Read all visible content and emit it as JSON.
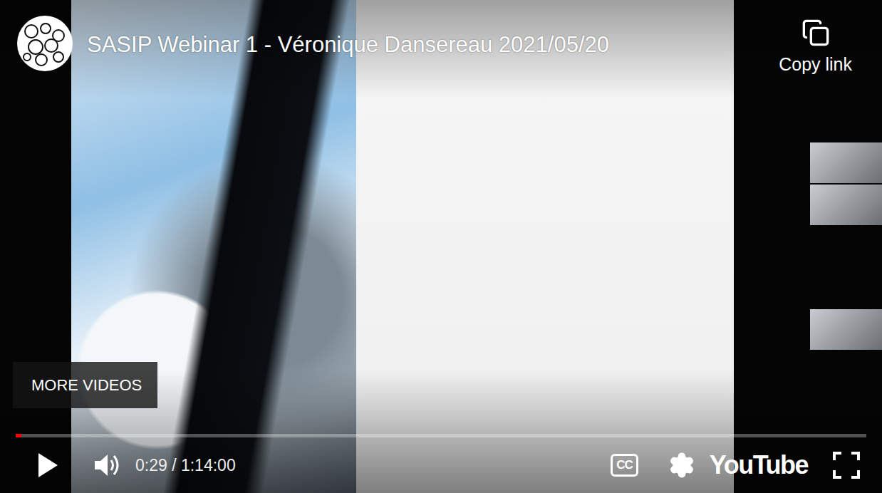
{
  "video": {
    "title": "SASIP Webinar 1 - Véronique Dansereau 2021/05/20"
  },
  "share": {
    "label": "Copy link"
  },
  "more_videos": {
    "label": "MORE VIDEOS"
  },
  "player": {
    "playing": false,
    "muted": false,
    "progress": {
      "level": 0.0065
    },
    "time": "0:29 / 1:14:00",
    "captions_label": "CC",
    "brand": "YouTube"
  }
}
